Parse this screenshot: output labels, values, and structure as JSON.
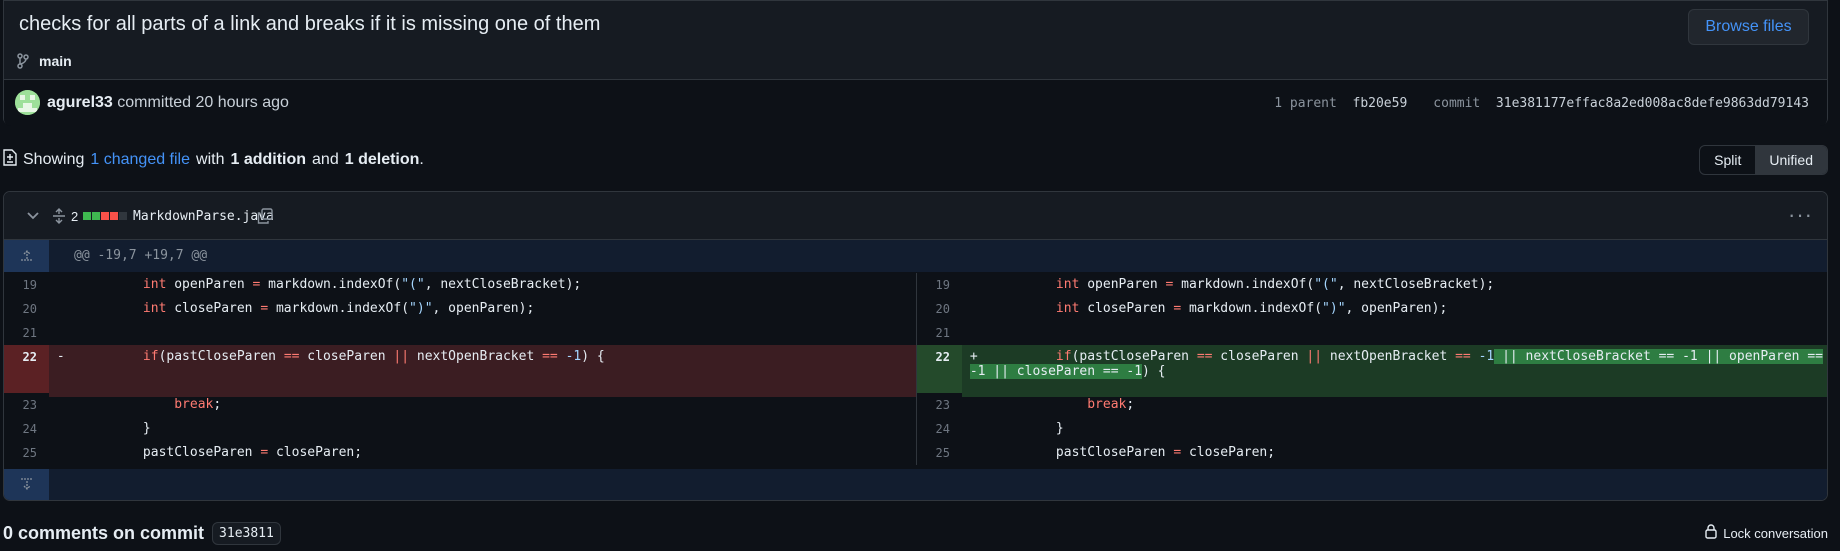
{
  "commit": {
    "title": "checks for all parts of a link and breaks if it is missing one of them",
    "browse_label": "Browse files",
    "branch": "main",
    "author": "agurel33",
    "committed_text": "committed 20 hours ago",
    "parent_label": "1 parent",
    "parent_sha": "fb20e59",
    "commit_label": "commit",
    "commit_sha": "31e381177effac8a2ed008ac8defe9863dd79143"
  },
  "summary": {
    "showing": "Showing",
    "changed_files": "1 changed file",
    "with": "with",
    "additions": "1 addition",
    "and": "and",
    "deletions": "1 deletion",
    "period": "."
  },
  "view_toggle": {
    "split": "Split",
    "unified": "Unified",
    "active": "Split"
  },
  "file": {
    "changes": "2",
    "name": "MarkdownParse.java",
    "hunk_header": "@@ -19,7 +19,7 @@",
    "diffstat": [
      "#3fb950",
      "#3fb950",
      "#f85149",
      "#f85149",
      "#30363d"
    ]
  },
  "footer": {
    "comments_text": "0 comments on commit",
    "short_sha": "31e3811",
    "lock_label": "Lock conversation"
  },
  "colors": {
    "accent": "#4493f8",
    "addition": "#3fb950",
    "deletion": "#f85149"
  }
}
